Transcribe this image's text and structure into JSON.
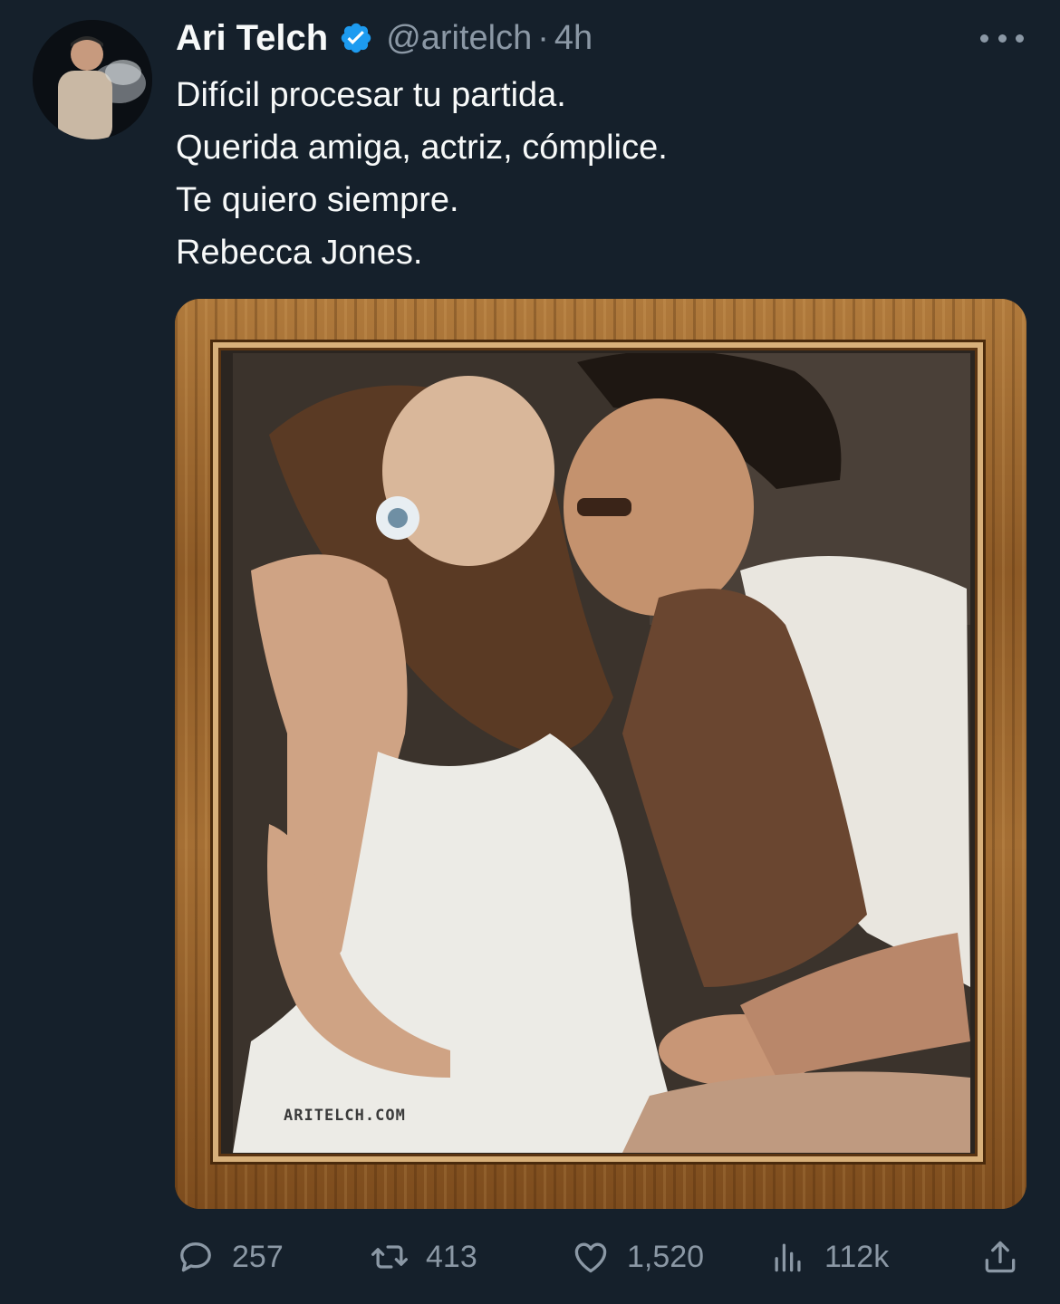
{
  "tweet": {
    "author_name": "Ari Telch",
    "handle": "@aritelch",
    "separator": "·",
    "time": "4h",
    "text_lines": [
      "Difícil procesar tu partida.",
      "Querida amiga, actriz, cómplice.",
      "Te quiero siempre.",
      "Rebecca Jones."
    ],
    "media_watermark": "ARITELCH.COM"
  },
  "actions": {
    "replies": "257",
    "retweets": "413",
    "likes": "1,520",
    "views": "112k"
  },
  "colors": {
    "background": "#15202b",
    "text": "#f7f9f9",
    "secondary": "#8b98a5",
    "verified": "#1d9bf0"
  },
  "icons": [
    "verified-badge-icon",
    "more-icon",
    "reply-icon",
    "retweet-icon",
    "like-icon",
    "views-icon",
    "share-icon"
  ]
}
